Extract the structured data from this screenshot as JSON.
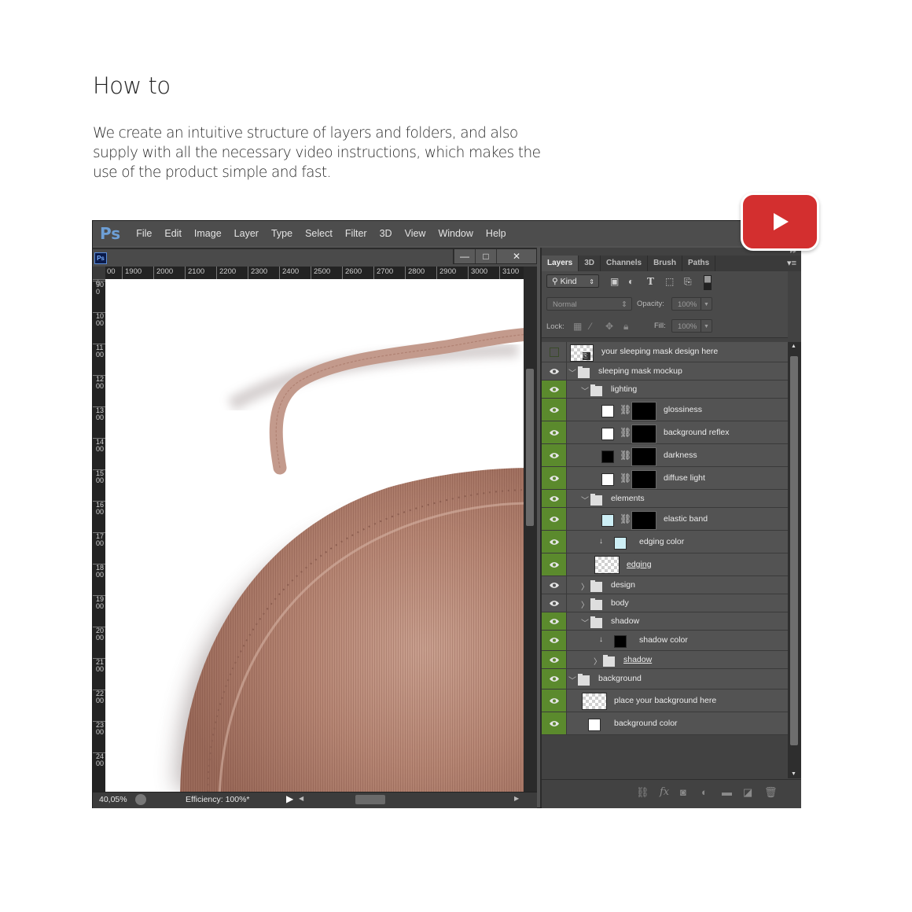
{
  "heading": "How to",
  "description": "We create an intuitive structure of layers and folders, and also supply with all the necessary video instructions, which makes the use of the product simple and fast.",
  "youtube": {
    "icon": "youtube-play-icon",
    "color": "#d32f2f"
  },
  "app": {
    "logo": "Ps",
    "menu": [
      "File",
      "Edit",
      "Image",
      "Layer",
      "Type",
      "Select",
      "Filter",
      "3D",
      "View",
      "Window",
      "Help"
    ],
    "doc_icon": "Ps",
    "window_buttons": {
      "minimize": "—",
      "restore": "□",
      "close": "✕"
    },
    "hruler": [
      "00",
      "1900",
      "2000",
      "2100",
      "2200",
      "2300",
      "2400",
      "2500",
      "2600",
      "2700",
      "2800",
      "2900",
      "3000",
      "3100"
    ],
    "vruler": [
      "0",
      "900",
      "1000",
      "1100",
      "1200",
      "1300",
      "1400",
      "1500",
      "1600",
      "1700",
      "1800",
      "1900",
      "2000",
      "2100",
      "2200",
      "2300",
      "2400"
    ],
    "status": {
      "zoom": "40,05%",
      "efficiency": "Efficiency: 100%*"
    }
  },
  "panel": {
    "tabs": [
      "Layers",
      "3D",
      "Channels",
      "Brush",
      "Paths"
    ],
    "active_tab": "Layers",
    "filter": {
      "label": "Kind"
    },
    "blend_mode": "Normal",
    "opacity_label": "Opacity:",
    "opacity_value": "100%",
    "lock_label": "Lock:",
    "fill_label": "Fill:",
    "fill_value": "100%",
    "layers": [
      {
        "name": "your sleeping mask design here",
        "visible": false,
        "type": "smart"
      },
      {
        "name": "sleeping mask mockup",
        "visible": true,
        "highlight": false,
        "type": "group",
        "expanded": true
      },
      {
        "name": "lighting",
        "visible": true,
        "type": "group",
        "expanded": true
      },
      {
        "name": "glossiness",
        "visible": true,
        "type": "adjust",
        "swatch": "#ffffff"
      },
      {
        "name": "background reflex",
        "visible": true,
        "type": "adjust",
        "swatch": "#ffffff"
      },
      {
        "name": "darkness",
        "visible": true,
        "type": "adjust",
        "swatch": "#000000"
      },
      {
        "name": "diffuse light",
        "visible": true,
        "type": "adjust",
        "swatch": "#ffffff"
      },
      {
        "name": "elements",
        "visible": true,
        "type": "group",
        "expanded": true
      },
      {
        "name": "elastic band",
        "visible": true,
        "type": "adjust",
        "swatch": "#cdeef5"
      },
      {
        "name": "edging color",
        "visible": true,
        "type": "clip",
        "swatch": "#cdeef5"
      },
      {
        "name": "edging",
        "visible": true,
        "type": "pixel"
      },
      {
        "name": "design",
        "visible": true,
        "highlight": false,
        "type": "group",
        "expanded": false
      },
      {
        "name": "body",
        "visible": true,
        "highlight": false,
        "type": "group",
        "expanded": false
      },
      {
        "name": "shadow",
        "visible": true,
        "type": "group",
        "expanded": true
      },
      {
        "name": "shadow color",
        "visible": true,
        "type": "clip",
        "swatch": "#000000"
      },
      {
        "name": "shadow",
        "visible": true,
        "type": "group-u",
        "expanded": false
      },
      {
        "name": "background",
        "visible": true,
        "type": "group",
        "expanded": true
      },
      {
        "name": "place your background here",
        "visible": true,
        "type": "pixel2"
      },
      {
        "name": "background color",
        "visible": true,
        "type": "fill",
        "swatch": "#ffffff"
      }
    ]
  }
}
